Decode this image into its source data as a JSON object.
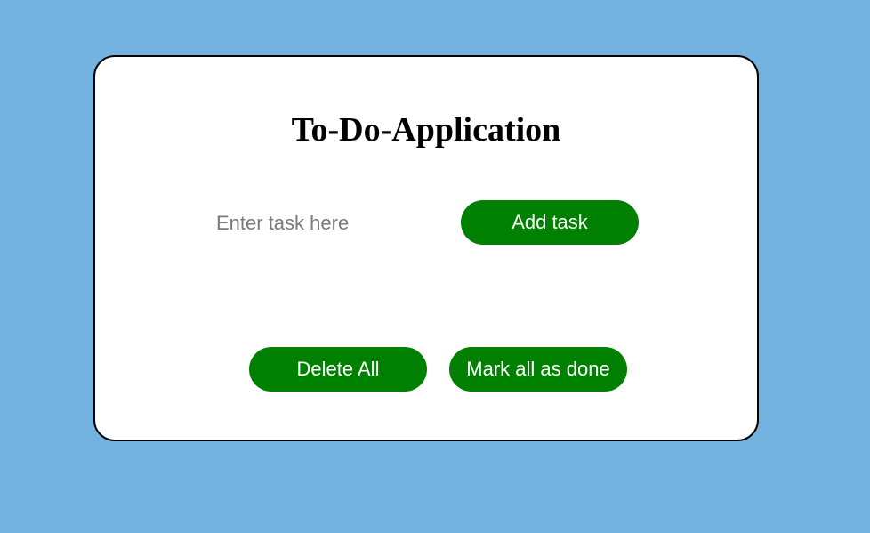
{
  "app": {
    "title": "To-Do-Application"
  },
  "task_input": {
    "placeholder": "Enter task here",
    "value": ""
  },
  "buttons": {
    "add": "Add task",
    "delete_all": "Delete All",
    "mark_all_done": "Mark all as done"
  },
  "colors": {
    "background": "#74b2df",
    "card": "#ffffff",
    "button": "#008000",
    "button_text": "#ffffff"
  }
}
